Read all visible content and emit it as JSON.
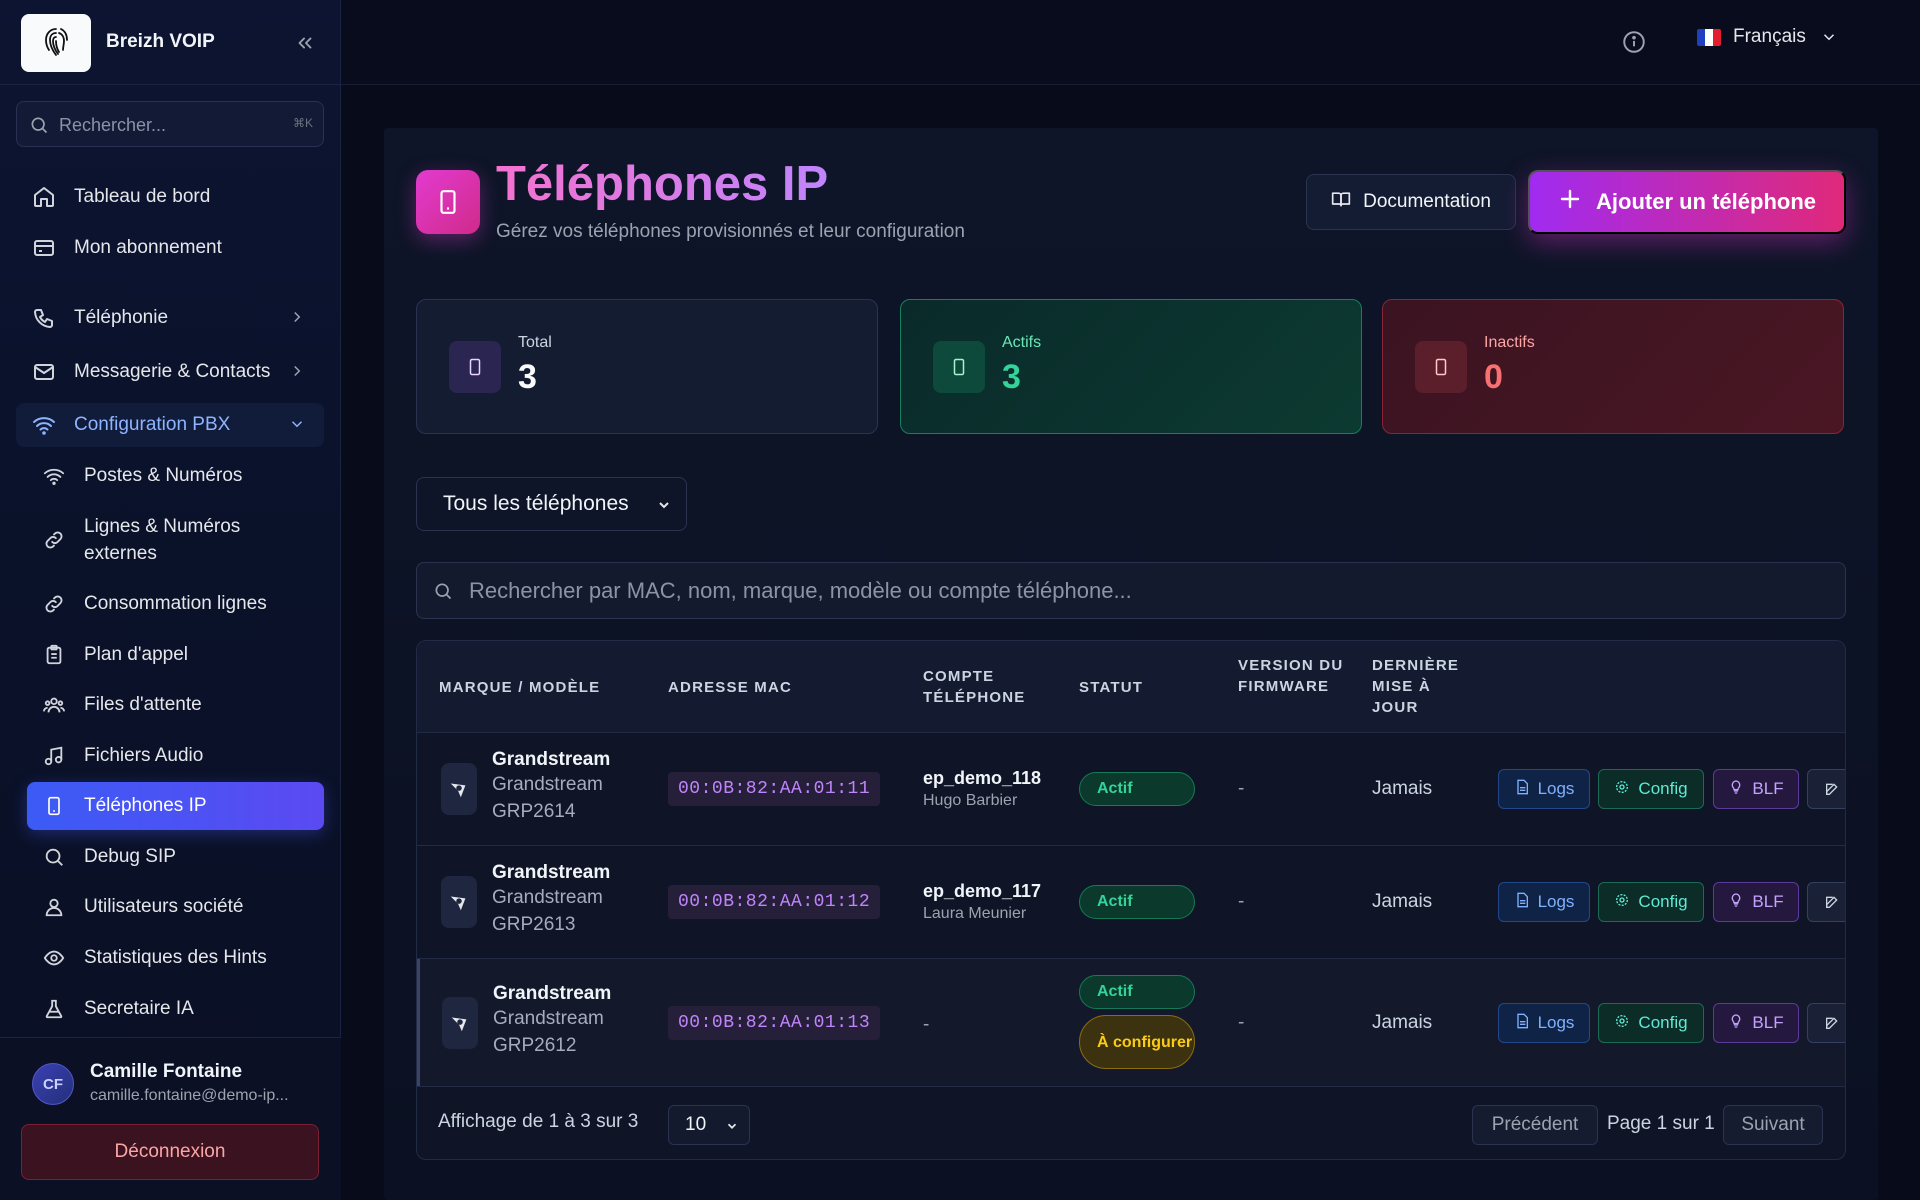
{
  "sidebar": {
    "brand_name": "Breizh VOIP",
    "search": {
      "placeholder": "Rechercher...",
      "shortcut": "⌘K"
    },
    "items": [
      {
        "label": "Tableau de bord",
        "icon": "home-icon"
      },
      {
        "label": "Mon abonnement",
        "icon": "credit-card-icon"
      },
      {
        "label": "Téléphonie",
        "icon": "phone-icon"
      },
      {
        "label": "Messagerie & Contacts",
        "icon": "mail-icon"
      },
      {
        "label": "Configuration PBX",
        "icon": "wifi-icon",
        "expanded": true
      }
    ],
    "sub_items": [
      {
        "label": "Postes & Numéros",
        "icon": "wifi-icon"
      },
      {
        "label": "Lignes & Numéros externes",
        "icon": "link-icon"
      },
      {
        "label": "Consommation lignes",
        "icon": "link-icon"
      },
      {
        "label": "Plan d'appel",
        "icon": "clipboard-icon"
      },
      {
        "label": "Files d'attente",
        "icon": "users-icon"
      },
      {
        "label": "Fichiers Audio",
        "icon": "music-icon"
      },
      {
        "label": "Téléphones IP",
        "icon": "smartphone-icon",
        "active": true
      },
      {
        "label": "Debug SIP",
        "icon": "search-icon"
      },
      {
        "label": "Utilisateurs société",
        "icon": "user-group-icon"
      },
      {
        "label": "Statistiques des Hints",
        "icon": "eye-icon"
      },
      {
        "label": "Secretaire IA",
        "icon": "flask-icon"
      }
    ],
    "user": {
      "initials": "CF",
      "name": "Camille Fontaine",
      "email": "camille.fontaine@demo-ip..."
    },
    "logout_label": "Déconnexion"
  },
  "topbar": {
    "language": "Français"
  },
  "page": {
    "title": "Téléphones IP",
    "subtitle": "Gérez vos téléphones provisionnés et leur configuration",
    "doc_button": "Documentation",
    "add_button": "Ajouter un téléphone"
  },
  "stats": {
    "total": {
      "label": "Total",
      "value": "3"
    },
    "actifs": {
      "label": "Actifs",
      "value": "3"
    },
    "inactifs": {
      "label": "Inactifs",
      "value": "0"
    }
  },
  "filter": {
    "selected": "Tous les téléphones"
  },
  "table_search": {
    "placeholder": "Rechercher par MAC, nom, marque, modèle ou compte téléphone..."
  },
  "table": {
    "headers": {
      "model": "MARQUE / MODÈLE",
      "mac": "ADRESSE MAC",
      "account": "COMPTE TÉLÉPHONE",
      "status": "STATUT",
      "firmware": "VERSION DU FIRMWARE",
      "updated": "DERNIÈRE MISE À JOUR"
    },
    "rows": [
      {
        "brand": "Grandstream",
        "model": "Grandstream GRP2614",
        "mac": "00:0B:82:AA:01:11",
        "account": "ep_demo_118",
        "account_user": "Hugo Barbier",
        "status": "Actif",
        "firmware": "-",
        "updated": "Jamais"
      },
      {
        "brand": "Grandstream",
        "model": "Grandstream GRP2613",
        "mac": "00:0B:82:AA:01:12",
        "account": "ep_demo_117",
        "account_user": "Laura Meunier",
        "status": "Actif",
        "firmware": "-",
        "updated": "Jamais"
      },
      {
        "brand": "Grandstream",
        "model": "Grandstream GRP2612",
        "mac": "00:0B:82:AA:01:13",
        "account": "-",
        "account_user": "",
        "status": "Actif",
        "status2": "À configurer",
        "firmware": "-",
        "updated": "Jamais"
      }
    ],
    "actions": {
      "logs": "Logs",
      "config": "Config",
      "blf": "BLF"
    }
  },
  "pagination": {
    "info": "Affichage de 1 à 3 sur 3",
    "page_size": "10",
    "prev": "Précédent",
    "page_info": "Page 1 sur 1",
    "next": "Suivant"
  },
  "colors": {
    "accent": "#3b5bf5",
    "primary_gradient_start": "#a02bf0",
    "primary_gradient_end": "#e0297a",
    "success": "#34d399",
    "danger": "#f87171",
    "warning": "#facc15"
  }
}
